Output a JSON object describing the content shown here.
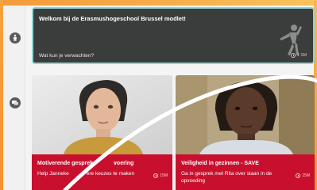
{
  "intro_card": {
    "title": "Welkom bij de Erasmushogeschool Brussel modlet!",
    "subtitle": "Wat kun je verwachten?",
    "duration": "1 SM"
  },
  "courses": [
    {
      "title": "Motiverende gesprek",
      "title_suffix": "voering",
      "description": "Help Janneke",
      "description_suffix": "ere keuzes te maken",
      "duration": "15M"
    },
    {
      "title": "Veiligheid in gezinnen - SAVE",
      "description": "Ga in gesprek met Rita over slaan in de opvoeding",
      "duration": "15M"
    }
  ],
  "sidebar": {
    "icons": [
      "person-icon",
      "chat-icon"
    ]
  },
  "colors": {
    "brand_orange": "#f49a3a",
    "card_red": "#c8102e",
    "intro_bg": "#3b3d3c",
    "intro_border": "#8fd6d2"
  }
}
